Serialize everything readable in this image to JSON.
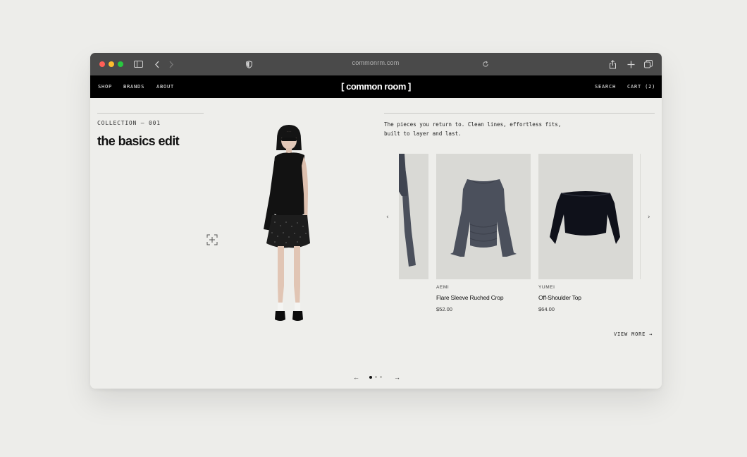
{
  "browser": {
    "url": "commonrm.com"
  },
  "nav": {
    "links": [
      "SHOP",
      "BRANDS",
      "ABOUT"
    ],
    "logo": "[ common room ]",
    "search": "SEARCH",
    "cart": "CART (2)"
  },
  "hero": {
    "collection": "COLLECTION — 001",
    "title": "the basics edit",
    "description_line1": "The pieces you return to. Clean lines, effortless fits,",
    "description_line2": "built to layer and last."
  },
  "products": [
    {
      "brand": "",
      "name": "",
      "price": ""
    },
    {
      "brand": "AEMI",
      "name": "Flare Sleeve Ruched Crop",
      "price": "$52.00"
    },
    {
      "brand": "YUMEI",
      "name": "Off-Shoulder Top",
      "price": "$64.00"
    }
  ],
  "view_more": "VIEW MORE →",
  "pagination": {
    "pages": 3,
    "current": 1
  },
  "colors": {
    "page_bg": "#ededea",
    "nav_bg": "#000000",
    "card_bg": "#d9d9d5",
    "garment_slate": "#4b505c",
    "garment_black": "#0f111a"
  }
}
